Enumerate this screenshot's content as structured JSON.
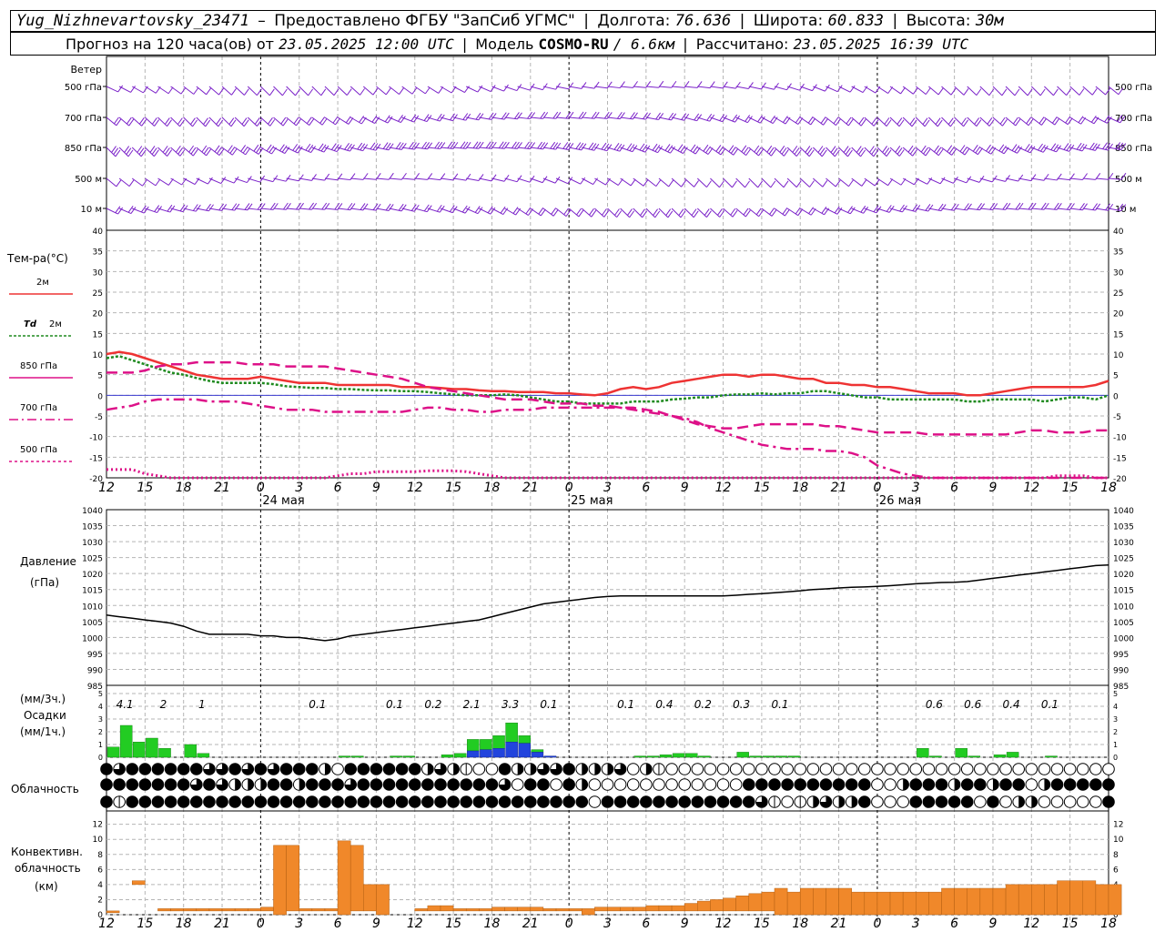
{
  "header": {
    "station": "Yug_Nizhnevartovsky_23471",
    "dash": "–",
    "provider": "Предоставлено ФГБУ \"ЗапСиб УГМС\"",
    "lon_label": "Долгота:",
    "lon_value": "76.636",
    "lat_label": "Широта:",
    "lat_value": "60.833",
    "alt_label": "Высота:",
    "alt_value": "30м",
    "forecast_prefix": "Прогноз на 120 часа(ов) от",
    "forecast_start": "23.05.2025 12:00 UTC",
    "model_label": "Модель",
    "model_name": "COSMO-RU",
    "model_res": "/ 6.6км",
    "computed_label": "Рассчитано:",
    "computed_value": "23.05.2025 16:39 UTC"
  },
  "time_axis": {
    "hour_labels": [
      "12",
      "15",
      "18",
      "21",
      "0",
      "3",
      "6",
      "9",
      "12",
      "15",
      "18",
      "21",
      "0",
      "3",
      "6",
      "9",
      "12",
      "15",
      "18",
      "21",
      "0",
      "3",
      "6",
      "9",
      "12",
      "15",
      "18"
    ],
    "day_labels": [
      "24 мая",
      "25 мая",
      "26 мая"
    ]
  },
  "wind_panel": {
    "title": "Ветер",
    "levels": [
      "500 гПа",
      "700 гПа",
      "850 гПа",
      "500 м",
      "10 м"
    ],
    "color": "#7b22c9"
  },
  "temp_panel": {
    "title": "Тем-ра(°C)",
    "legend": [
      {
        "label": "2м",
        "color": "#ee3333"
      },
      {
        "label_prefix": "Td",
        "label": "2м",
        "color": "#1f8a1f"
      },
      {
        "label": "850 гПа",
        "color": "#dd1188"
      },
      {
        "label": "700 гПа",
        "color": "#dd1188"
      },
      {
        "label": "500 гПа",
        "color": "#dd1188"
      }
    ],
    "yticks": [
      "40",
      "35",
      "30",
      "25",
      "20",
      "15",
      "10",
      "5",
      "0",
      "-5",
      "-10",
      "-15",
      "-20"
    ]
  },
  "pressure_panel": {
    "title": "Давление",
    "unit": "(гПа)",
    "yticks": [
      "1040",
      "1035",
      "1030",
      "1025",
      "1020",
      "1015",
      "1010",
      "1005",
      "1000",
      "995",
      "990",
      "985"
    ]
  },
  "precip_panel": {
    "title_1": "(мм/3ч.)",
    "title_2": "Осадки",
    "title_3": "(мм/1ч.)",
    "yticks": [
      "5",
      "4",
      "3",
      "2",
      "1",
      "0"
    ],
    "totals": [
      {
        "h": 1,
        "v": "4.1"
      },
      {
        "h": 4,
        "v": "2"
      },
      {
        "h": 7,
        "v": "1"
      },
      {
        "h": 16,
        "v": "0.1"
      },
      {
        "h": 22,
        "v": "0.1"
      },
      {
        "h": 25,
        "v": "0.2"
      },
      {
        "h": 28,
        "v": "2.1"
      },
      {
        "h": 31,
        "v": "3.3"
      },
      {
        "h": 34,
        "v": "0.1"
      },
      {
        "h": 40,
        "v": "0.1"
      },
      {
        "h": 43,
        "v": "0.4"
      },
      {
        "h": 46,
        "v": "0.2"
      },
      {
        "h": 49,
        "v": "0.3"
      },
      {
        "h": 52,
        "v": "0.1"
      },
      {
        "h": 64,
        "v": "0.6"
      },
      {
        "h": 67,
        "v": "0.6"
      },
      {
        "h": 70,
        "v": "0.4"
      },
      {
        "h": 73,
        "v": "0.1"
      }
    ]
  },
  "cloud_panel": {
    "title": "Облачность"
  },
  "conv_panel": {
    "title_1": "Конвективн.",
    "title_2": "облачность",
    "title_3": "(км)",
    "yticks": [
      "12",
      "10",
      "8",
      "6",
      "4",
      "2",
      "0"
    ],
    "color": "#f0882a"
  },
  "chart_data": {
    "type": "line",
    "x_hours_from_start": [
      0,
      1,
      2,
      3,
      4,
      5,
      6,
      7,
      8,
      9,
      10,
      11,
      12,
      13,
      14,
      15,
      16,
      17,
      18,
      19,
      20,
      21,
      22,
      23,
      24,
      25,
      26,
      27,
      28,
      29,
      30,
      31,
      32,
      33,
      34,
      35,
      36,
      37,
      38,
      39,
      40,
      41,
      42,
      43,
      44,
      45,
      46,
      47,
      48,
      49,
      50,
      51,
      52,
      53,
      54,
      55,
      56,
      57,
      58,
      59,
      60,
      61,
      62,
      63,
      64,
      65,
      66,
      67,
      68,
      69,
      70,
      71,
      72,
      73,
      74,
      75,
      76,
      77,
      78
    ],
    "series": [
      {
        "name": "2м",
        "values": [
          10,
          10.5,
          10,
          9,
          8,
          7,
          6,
          5,
          4.5,
          4,
          4,
          4,
          4.5,
          4,
          3.5,
          3,
          3,
          3,
          2.5,
          2.5,
          2.5,
          2.5,
          2.5,
          2,
          2,
          2,
          1.8,
          1.5,
          1.5,
          1.2,
          1,
          1,
          0.8,
          0.8,
          0.8,
          0.5,
          0.5,
          0.2,
          0,
          0.5,
          1.5,
          2,
          1.5,
          2,
          3,
          3.5,
          4,
          4.5,
          5,
          5,
          4.5,
          5,
          5,
          4.5,
          4,
          4,
          3,
          3,
          2.5,
          2.5,
          2,
          2,
          1.5,
          1,
          0.5,
          0.5,
          0.5,
          0,
          0,
          0.5,
          1,
          1.5,
          2,
          2,
          2,
          2,
          2,
          2.5,
          3.5
        ]
      },
      {
        "name": "Td 2м",
        "values": [
          9,
          9.5,
          8.5,
          7.5,
          6.5,
          5.5,
          5,
          4.2,
          3.5,
          3,
          3,
          3,
          3,
          2.7,
          2.2,
          2,
          1.8,
          1.8,
          1.5,
          1.5,
          1.3,
          1.2,
          1.2,
          1,
          1,
          0.8,
          0.5,
          0.2,
          0,
          0,
          0,
          0.2,
          0,
          -0.5,
          -1,
          -1.5,
          -1.5,
          -2,
          -2,
          -2,
          -2,
          -1.5,
          -1.5,
          -1.5,
          -1,
          -0.8,
          -0.5,
          -0.5,
          0,
          0.2,
          0.2,
          0.5,
          0.2,
          0.5,
          0.5,
          1,
          1,
          0.5,
          0,
          -0.5,
          -0.5,
          -1,
          -1,
          -1,
          -1,
          -1,
          -1,
          -1.5,
          -1.5,
          -1,
          -1,
          -1,
          -1,
          -1.5,
          -1,
          -0.5,
          -0.5,
          -1,
          0
        ]
      },
      {
        "name": "850 гПа",
        "values": [
          5.5,
          5.5,
          5.5,
          6,
          7,
          7.5,
          7.5,
          8,
          8,
          8,
          8,
          7.5,
          7.5,
          7.5,
          7,
          7,
          7,
          7,
          6.5,
          6,
          5.5,
          5,
          4.5,
          4,
          3,
          2,
          1.5,
          1,
          0.5,
          0,
          -0.5,
          -1,
          -1,
          -1,
          -1.5,
          -2,
          -2,
          -2,
          -2.5,
          -2.5,
          -3,
          -3,
          -3.5,
          -4,
          -5,
          -6,
          -7,
          -7.5,
          -8,
          -8,
          -7.5,
          -7,
          -7,
          -7,
          -7,
          -7,
          -7.5,
          -7.5,
          -8,
          -8.5,
          -9,
          -9,
          -9,
          -9,
          -9.5,
          -9.5,
          -9.5,
          -9.5,
          -9.5,
          -9.5,
          -9.5,
          -9,
          -8.5,
          -8.5,
          -9,
          -9,
          -9,
          -8.5,
          -8.5
        ]
      },
      {
        "name": "700 гПа",
        "values": [
          -3.5,
          -3,
          -2.5,
          -1.5,
          -1,
          -1,
          -1,
          -1,
          -1.5,
          -1.5,
          -1.5,
          -2,
          -2.5,
          -3,
          -3.5,
          -3.5,
          -3.5,
          -4,
          -4,
          -4,
          -4,
          -4,
          -4,
          -4,
          -3.5,
          -3,
          -3,
          -3.5,
          -3.5,
          -4,
          -4,
          -3.5,
          -3.5,
          -3.5,
          -3,
          -3,
          -3,
          -3,
          -3,
          -3,
          -3,
          -3.5,
          -4,
          -4.5,
          -5,
          -5.5,
          -6.5,
          -8,
          -9,
          -10,
          -11,
          -12,
          -12.5,
          -13,
          -13,
          -13,
          -13.5,
          -13.5,
          -14,
          -15,
          -17,
          -18,
          -19,
          -19.5,
          -20,
          -20,
          -20,
          -20,
          -20,
          -20,
          -20,
          -20,
          -20,
          -20,
          -20,
          -20,
          -20,
          -20,
          -20
        ]
      },
      {
        "name": "500 гПа",
        "values": [
          -18,
          -18,
          -18,
          -19,
          -19.5,
          -20,
          -20,
          -20,
          -20,
          -20,
          -20,
          -20,
          -20,
          -20,
          -20,
          -20,
          -20,
          -20,
          -19.5,
          -19,
          -19,
          -18.5,
          -18.5,
          -18.5,
          -18.5,
          -18.3,
          -18.3,
          -18.3,
          -18.5,
          -19,
          -19.5,
          -20,
          -20,
          -20,
          -20,
          -20,
          -20,
          -20,
          -20,
          -20,
          -20,
          -20,
          -20,
          -20,
          -20,
          -20,
          -20,
          -20,
          -20,
          -20,
          -20,
          -20,
          -20,
          -20,
          -20,
          -20,
          -20,
          -20,
          -20,
          -20,
          -20,
          -20,
          -20,
          -20,
          -20,
          -20,
          -20,
          -20,
          -20,
          -20,
          -20,
          -20,
          -20,
          -20,
          -19.5,
          -19.5,
          -19.5,
          -20,
          -20
        ]
      },
      {
        "name": "Давление",
        "values": [
          1007,
          1006.5,
          1006,
          1005.5,
          1005,
          1004.5,
          1003.5,
          1002,
          1001,
          1001,
          1001,
          1001,
          1000.5,
          1000.5,
          1000,
          1000,
          999.5,
          999,
          999.5,
          1000.5,
          1001,
          1001.5,
          1002,
          1002.5,
          1003,
          1003.5,
          1004,
          1004.5,
          1005,
          1005.5,
          1006.5,
          1007.5,
          1008.5,
          1009.5,
          1010.5,
          1011,
          1011.5,
          1012,
          1012.5,
          1012.8,
          1013,
          1013,
          1013,
          1013,
          1013,
          1013,
          1013,
          1013,
          1013,
          1013.2,
          1013.5,
          1013.7,
          1014,
          1014.3,
          1014.6,
          1015,
          1015.2,
          1015.5,
          1015.7,
          1015.8,
          1016,
          1016.2,
          1016.5,
          1016.8,
          1017,
          1017.2,
          1017.3,
          1017.5,
          1018,
          1018.5,
          1019,
          1019.5,
          1020,
          1020.5,
          1021,
          1021.5,
          1022,
          1022.5,
          1022.7
        ]
      }
    ],
    "precip_1h_liquid": [
      0.8,
      2.5,
      1.2,
      1.5,
      0.7,
      0,
      1,
      0.3,
      0,
      0,
      0,
      0,
      0,
      0,
      0,
      0,
      0,
      0,
      0.1,
      0.1,
      0,
      0,
      0.1,
      0.1,
      0,
      0,
      0.2,
      0.3,
      0.9,
      0.8,
      1,
      1.5,
      0.6,
      0.2,
      0,
      0,
      0,
      0,
      0,
      0,
      0,
      0.1,
      0.1,
      0.2,
      0.3,
      0.3,
      0.1,
      0,
      0,
      0.4,
      0.1,
      0.1,
      0.1,
      0.1,
      0,
      0,
      0,
      0,
      0,
      0,
      0,
      0,
      0,
      0.7,
      0.1,
      0,
      0.7,
      0.1,
      0,
      0.2,
      0.4,
      0,
      0,
      0.1,
      0,
      0,
      0,
      0,
      0
    ],
    "precip_1h_solid": [
      0,
      0,
      0,
      0,
      0,
      0,
      0,
      0,
      0,
      0,
      0,
      0,
      0,
      0,
      0,
      0,
      0,
      0,
      0,
      0,
      0,
      0,
      0,
      0,
      0,
      0,
      0,
      0,
      0.5,
      0.6,
      0.7,
      1.2,
      1.1,
      0.4,
      0.1,
      0,
      0,
      0,
      0,
      0,
      0,
      0,
      0,
      0,
      0,
      0,
      0,
      0,
      0,
      0,
      0,
      0,
      0,
      0,
      0,
      0,
      0,
      0,
      0,
      0,
      0,
      0,
      0,
      0,
      0,
      0,
      0,
      0,
      0,
      0,
      0,
      0,
      0,
      0,
      0,
      0,
      0,
      0,
      0
    ],
    "cloud_cover_rows": [
      [
        8,
        6,
        8,
        8,
        8,
        8,
        8,
        8,
        6,
        6,
        8,
        6,
        8,
        6,
        8,
        8,
        8,
        4,
        0,
        8,
        8,
        8,
        8,
        8,
        8,
        4,
        6,
        4,
        2,
        0,
        0,
        8,
        4,
        4,
        6,
        6,
        8,
        4,
        4,
        4,
        6,
        0,
        4,
        2,
        0,
        0,
        0,
        0,
        0,
        0,
        0,
        0,
        0,
        0,
        0,
        0,
        0,
        0,
        0,
        0,
        0,
        0,
        0,
        0,
        0,
        0,
        0,
        0,
        0,
        0,
        0,
        0,
        0,
        0,
        0,
        0,
        0,
        0,
        0
      ],
      [
        8,
        8,
        8,
        8,
        8,
        8,
        8,
        6,
        8,
        6,
        4,
        4,
        4,
        8,
        8,
        4,
        8,
        8,
        8,
        6,
        8,
        8,
        8,
        8,
        8,
        8,
        8,
        8,
        8,
        8,
        8,
        6,
        0,
        8,
        8,
        0,
        8,
        4,
        0,
        0,
        0,
        0,
        0,
        0,
        0,
        0,
        0,
        0,
        0,
        0,
        8,
        8,
        8,
        8,
        8,
        8,
        8,
        8,
        8,
        8,
        0,
        0,
        4,
        8,
        8,
        8,
        4,
        8,
        8,
        4,
        8,
        8,
        0,
        4,
        8,
        8,
        8,
        8,
        8
      ],
      [
        8,
        2,
        8,
        8,
        8,
        8,
        8,
        8,
        8,
        8,
        8,
        8,
        8,
        8,
        8,
        8,
        8,
        8,
        8,
        8,
        8,
        8,
        8,
        8,
        8,
        8,
        8,
        8,
        8,
        8,
        8,
        8,
        8,
        8,
        8,
        8,
        8,
        8,
        0,
        8,
        8,
        8,
        8,
        8,
        8,
        8,
        8,
        8,
        8,
        8,
        8,
        6,
        2,
        0,
        2,
        4,
        6,
        4,
        4,
        8,
        0,
        0,
        0,
        8,
        8,
        8,
        8,
        8,
        0,
        8,
        0,
        4,
        4,
        0,
        0,
        0,
        0,
        0,
        8
      ]
    ],
    "conv_base_km": [
      0.5,
      0,
      4,
      0,
      0.5,
      0.5,
      0.5,
      0.5,
      0.5,
      0.5,
      0.5,
      0.5,
      0.5,
      0,
      0.5,
      0.5,
      0.5,
      0.5,
      0,
      0.5,
      0.5,
      0,
      0,
      0,
      0.5,
      0.5,
      0.5,
      0.5,
      0.5,
      0.5,
      0.5,
      0.5,
      0.5,
      0.5,
      0.5,
      0.5,
      0.5,
      0,
      0.5,
      0.5,
      0.5,
      0.5,
      0.5,
      0.5,
      0.5,
      0.5,
      0.5,
      0.5,
      0.5,
      0.5,
      0.5,
      0.5,
      0,
      0,
      0,
      0,
      0,
      0,
      0,
      0,
      0,
      0,
      0,
      0,
      0,
      0,
      0,
      0,
      0,
      0,
      0,
      0,
      0,
      0,
      0,
      0,
      0,
      0
    ],
    "conv_top_km": [
      0.5,
      0,
      4.5,
      0,
      0.8,
      0.8,
      0.8,
      0.8,
      0.8,
      0.8,
      0.8,
      0.8,
      1.0,
      9.2,
      9.2,
      0.8,
      0.8,
      0.8,
      9.8,
      9.2,
      4,
      4,
      0,
      0,
      0.8,
      1.2,
      1.2,
      0.8,
      0.8,
      0.8,
      1.0,
      1.0,
      1.0,
      1.0,
      0.8,
      0.8,
      0.8,
      0.8,
      1.0,
      1.0,
      1.0,
      1.0,
      1.2,
      1.2,
      1.2,
      1.5,
      1.8,
      2.0,
      2.2,
      2.5,
      2.8,
      3.0,
      3.5,
      3.0,
      3.5,
      3.5,
      3.5,
      3.5,
      3.0,
      3.0,
      3.0,
      3.0,
      3.0,
      3.0,
      3.0,
      3.5,
      3.5,
      3.5,
      3.5,
      3.5,
      4.0,
      4.0,
      4.0,
      4.0,
      4.5,
      4.5,
      4.5,
      4.0,
      4.0
    ],
    "xlabel": "",
    "ylabel": "",
    "ylim_temp": [
      -20,
      40
    ],
    "ylim_pressure": [
      985,
      1040
    ],
    "ylim_precip": [
      0,
      5
    ],
    "ylim_conv": [
      0,
      13
    ]
  }
}
